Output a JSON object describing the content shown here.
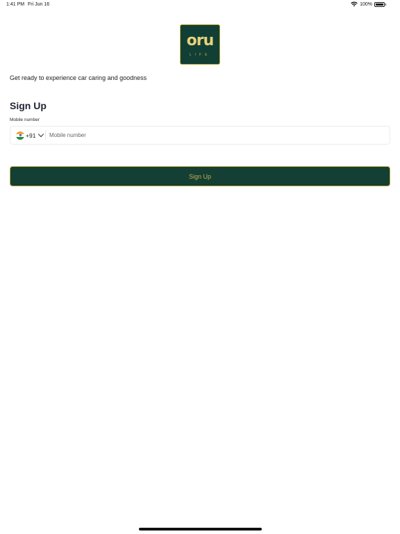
{
  "status_bar": {
    "time": "1:41 PM",
    "date": "Fri Jun 16",
    "battery": "100%",
    "battery_level": 1.0
  },
  "logo": {
    "word": "oru",
    "sub": "LIFE",
    "colors": {
      "background": "#123f35",
      "accent": "#c6a835",
      "text": "#e9d27a"
    }
  },
  "tagline": "Get ready to experience car caring and goodness",
  "signup": {
    "heading": "Sign Up",
    "mobile_label": "Mobile number",
    "country_code": "+91",
    "country_flag": "india-flag-icon",
    "mobile_placeholder": "Mobile number",
    "mobile_value": "",
    "button_label": "Sign Up"
  },
  "icons": {
    "wifi": "wifi-icon",
    "battery": "battery-icon",
    "chevron": "chevron-down-icon"
  }
}
